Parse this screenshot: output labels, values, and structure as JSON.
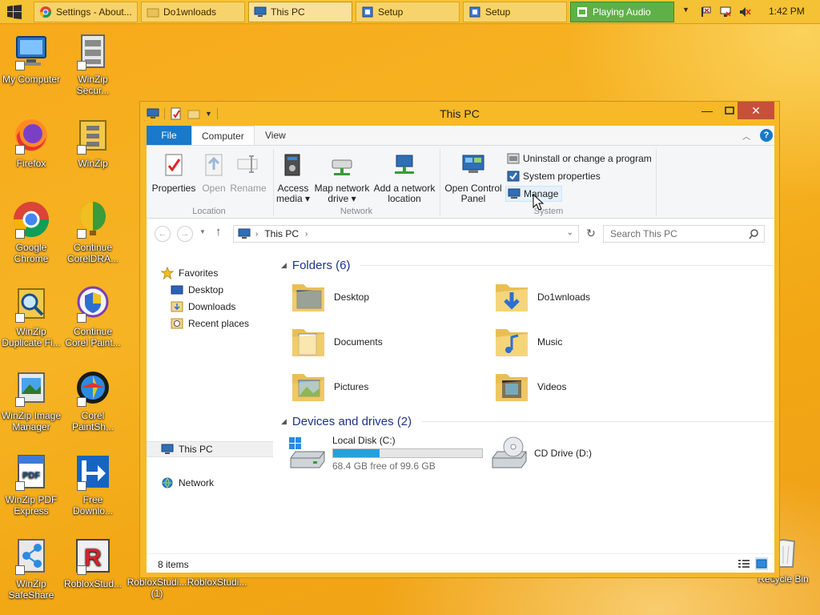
{
  "taskbar": {
    "tasks": [
      {
        "label": "Settings - About..."
      },
      {
        "label": "Do1wnloads"
      },
      {
        "label": "This PC"
      },
      {
        "label": "Setup"
      },
      {
        "label": "Setup"
      },
      {
        "label": "Playing Audio"
      }
    ],
    "clock": "1:42 PM"
  },
  "desktop_icons": [
    {
      "label": "My Computer"
    },
    {
      "label": "WinZip Secur..."
    },
    {
      "label": "Firefox"
    },
    {
      "label": "WinZip"
    },
    {
      "label": "Google Chrome"
    },
    {
      "label": "Continue CorelDRA..."
    },
    {
      "label": "WinZip Duplicate Fi..."
    },
    {
      "label": "Continue Corel Paint..."
    },
    {
      "label": "WinZip Image Manager"
    },
    {
      "label": "Corel PaintSh..."
    },
    {
      "label": "WinZip PDF Express"
    },
    {
      "label": "Free Downlo..."
    },
    {
      "label": "WinZip SafeShare"
    },
    {
      "label": "RobloxStud..."
    },
    {
      "label": "RobloxStudi... (1)"
    },
    {
      "label": "RobloxStudi..."
    },
    {
      "label": "Recycle Bin"
    }
  ],
  "window": {
    "title": "This PC",
    "tabs": {
      "file": "File",
      "computer": "Computer",
      "view": "View"
    },
    "ribbon": {
      "properties": "Properties",
      "open": "Open",
      "rename": "Rename",
      "access_media": [
        "Access",
        "media ▾"
      ],
      "map_drive": [
        "Map network",
        "drive ▾"
      ],
      "add_location": [
        "Add a network",
        "location"
      ],
      "open_cp": [
        "Open Control",
        "Panel"
      ],
      "uninstall": "Uninstall or change a program",
      "system_properties": "System properties",
      "manage": "Manage",
      "group_location": "Location",
      "group_network": "Network",
      "group_system": "System"
    },
    "address": {
      "path": "This PC",
      "search_placeholder": "Search This PC"
    },
    "nav": {
      "favorites": "Favorites",
      "desktop": "Desktop",
      "downloads": "Downloads",
      "recent": "Recent places",
      "this_pc": "This PC",
      "network": "Network"
    },
    "folders_header": "Folders (6)",
    "folders": [
      "Desktop",
      "Do1wnloads",
      "Documents",
      "Music",
      "Pictures",
      "Videos"
    ],
    "devices_header": "Devices and drives (2)",
    "drives": {
      "c_name": "Local Disk (C:)",
      "c_free": "68.4 GB free of 99.6 GB",
      "c_used_fraction": 0.313,
      "d_name": "CD Drive (D:)"
    },
    "status": "8 items"
  },
  "colors": {
    "accent": "#1979ca",
    "desktop": "#f6b51e",
    "close": "#c7503a",
    "drive_fill": "#26a0da"
  }
}
